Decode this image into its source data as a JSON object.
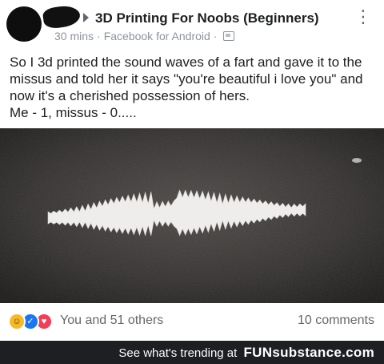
{
  "post": {
    "group_name": "3D Printing For Noobs (Beginners)",
    "time": "30 mins",
    "source": "Facebook for Android",
    "text_lines": [
      "So I 3d printed the sound waves of a fart and gave it to the missus and told her it says \"you're beautiful i love you\" and now it's a cherished possession of hers.",
      "Me - 1, missus - 0....."
    ],
    "photo_icon": "sound-wave-print-photo"
  },
  "reactions": {
    "icons": [
      "haha-icon",
      "like-icon",
      "love-icon"
    ],
    "count_text": "You and 51 others",
    "comments_text": "10 comments"
  },
  "footer": {
    "prefix": "See what's trending at",
    "brand": "FUNsubstance.com"
  },
  "colors": {
    "footer_bg": "#1d1f23",
    "like_blue": "#1877f2",
    "love_red": "#f33e58",
    "haha_yellow": "#f7b928"
  }
}
